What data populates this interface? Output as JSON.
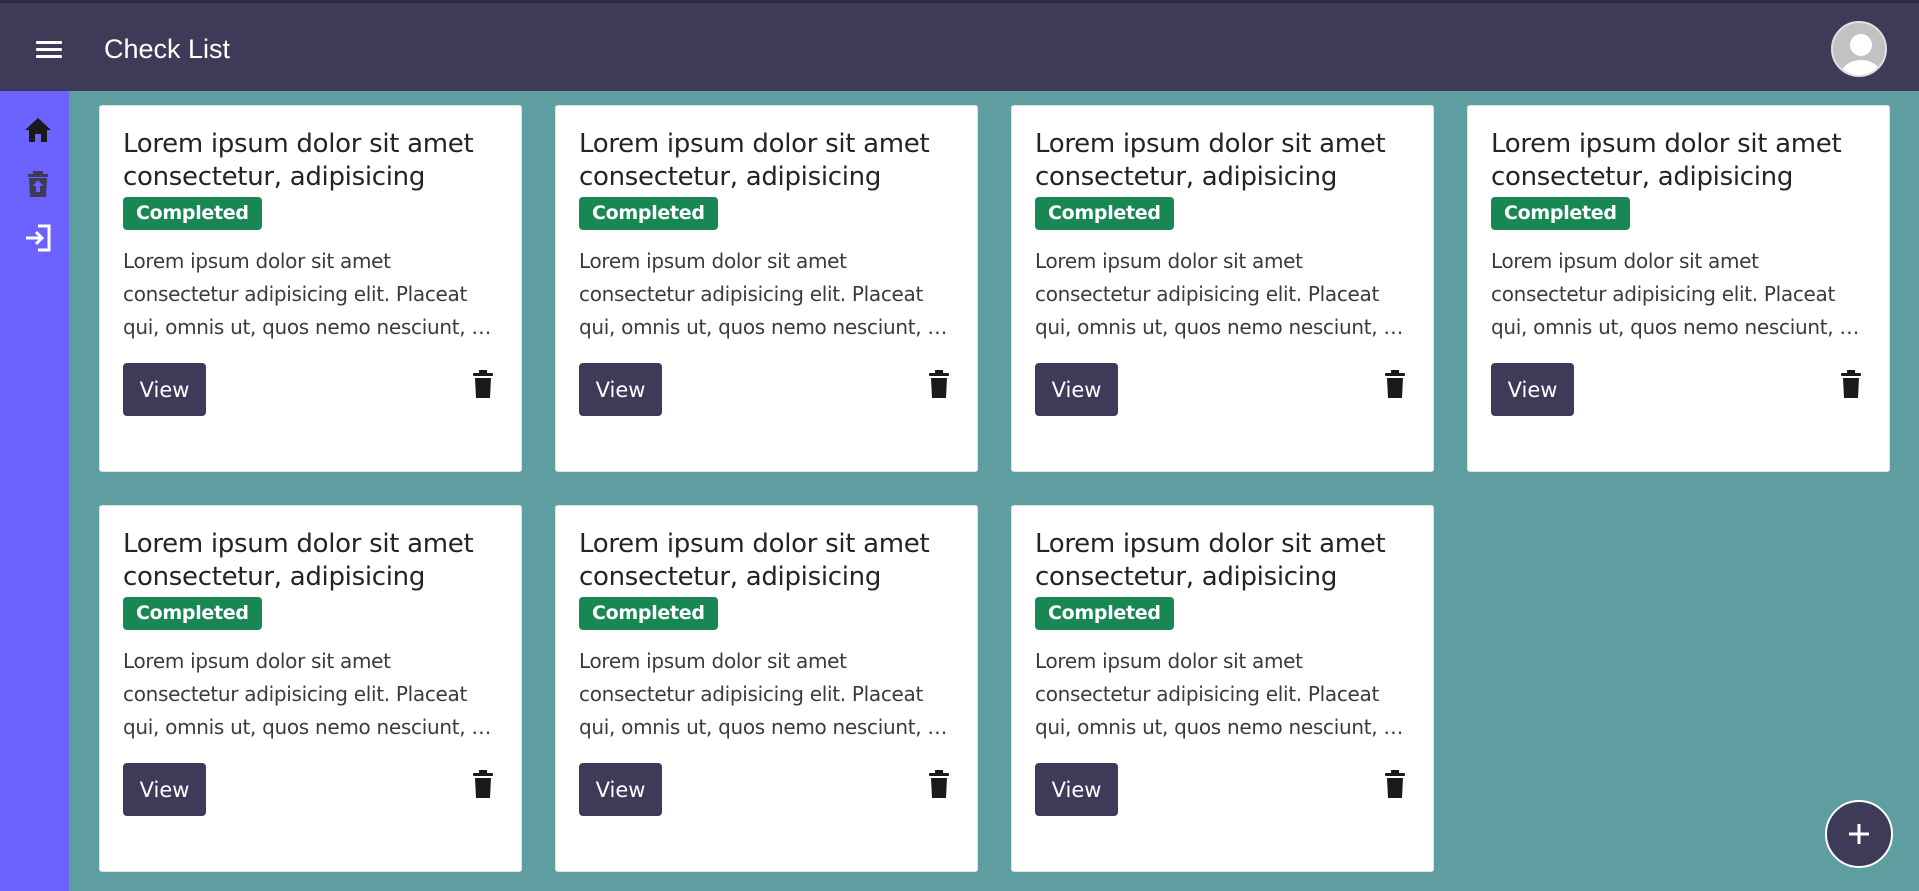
{
  "header": {
    "title": "Check List",
    "menu_icon": "hamburger-menu-icon",
    "avatar_icon": "user-avatar-icon"
  },
  "sidebar": {
    "items": [
      {
        "icon": "home-icon"
      },
      {
        "icon": "trash-restore-icon"
      },
      {
        "icon": "logout-icon"
      }
    ]
  },
  "cards": [
    {
      "title": "Lorem ipsum dolor sit amet consectetur, adipisicing",
      "status": "Completed",
      "text_lines": [
        "Lorem ipsum dolor sit amet",
        "consectetur adipisicing elit. Placeat",
        "qui, omnis ut, quos nemo nesciunt, e..."
      ],
      "view_label": "View"
    },
    {
      "title": "Lorem ipsum dolor sit amet consectetur, adipisicing",
      "status": "Completed",
      "text_lines": [
        "Lorem ipsum dolor sit amet",
        "consectetur adipisicing elit. Placeat",
        "qui, omnis ut, quos nemo nesciunt, e..."
      ],
      "view_label": "View"
    },
    {
      "title": "Lorem ipsum dolor sit amet consectetur, adipisicing",
      "status": "Completed",
      "text_lines": [
        "Lorem ipsum dolor sit amet",
        "consectetur adipisicing elit. Placeat",
        "qui, omnis ut, quos nemo nesciunt, e..."
      ],
      "view_label": "View"
    },
    {
      "title": "Lorem ipsum dolor sit amet consectetur, adipisicing",
      "status": "Completed",
      "text_lines": [
        "Lorem ipsum dolor sit amet",
        "consectetur adipisicing elit. Placeat",
        "qui, omnis ut, quos nemo nesciunt, e..."
      ],
      "view_label": "View"
    },
    {
      "title": "Lorem ipsum dolor sit amet consectetur, adipisicing",
      "status": "Completed",
      "text_lines": [
        "Lorem ipsum dolor sit amet",
        "consectetur adipisicing elit. Placeat",
        "qui, omnis ut, quos nemo nesciunt, e..."
      ],
      "view_label": "View"
    },
    {
      "title": "Lorem ipsum dolor sit amet consectetur, adipisicing",
      "status": "Completed",
      "text_lines": [
        "Lorem ipsum dolor sit amet",
        "consectetur adipisicing elit. Placeat",
        "qui, omnis ut, quos nemo nesciunt, e..."
      ],
      "view_label": "View"
    },
    {
      "title": "Lorem ipsum dolor sit amet consectetur, adipisicing",
      "status": "Completed",
      "text_lines": [
        "Lorem ipsum dolor sit amet",
        "consectetur adipisicing elit. Placeat",
        "qui, omnis ut, quos nemo nesciunt, e..."
      ],
      "view_label": "View"
    }
  ],
  "fab": {
    "label": "+",
    "icon": "plus-icon"
  },
  "colors": {
    "header": "#3d3b57",
    "sidebar": "#6c63ff",
    "background": "#5f9ea0",
    "badge": "#198754",
    "button": "#3d3b57"
  }
}
